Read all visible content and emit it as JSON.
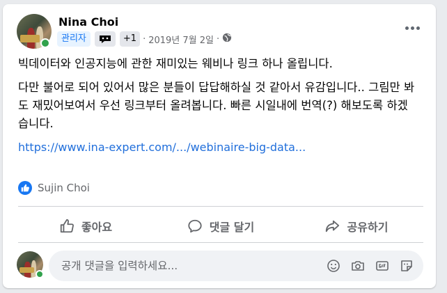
{
  "post": {
    "author": "Nina Choi",
    "role_badge": "관리자",
    "extra_badge": "+1",
    "date": "2019년 7월 2일",
    "separator": "·",
    "paragraphs": [
      "빅데이터와 인공지능에 관한 재미있는 웨비나 링크 하나 올립니다.",
      "다만 불어로 되어 있어서 많은 분들이 답답해하실 것 같아서 유감입니다.. 그림만 봐도 재밌어보여서 우선 링크부터 올려봅니다. 빠른 시일내에 번역(?) 해보도록 하겠습니다."
    ],
    "link": "https://www.ina-expert.com/.../webinaire-big-data...",
    "reaction_user": "Sujin Choi"
  },
  "actions": {
    "like": "좋아요",
    "comment": "댓글 달기",
    "share": "공유하기"
  },
  "comment_box": {
    "placeholder": "공개 댓글을 입력하세요..."
  },
  "colors": {
    "accent": "#1877f2",
    "link": "#216fdb",
    "online": "#31a24c",
    "muted": "#65676b"
  }
}
